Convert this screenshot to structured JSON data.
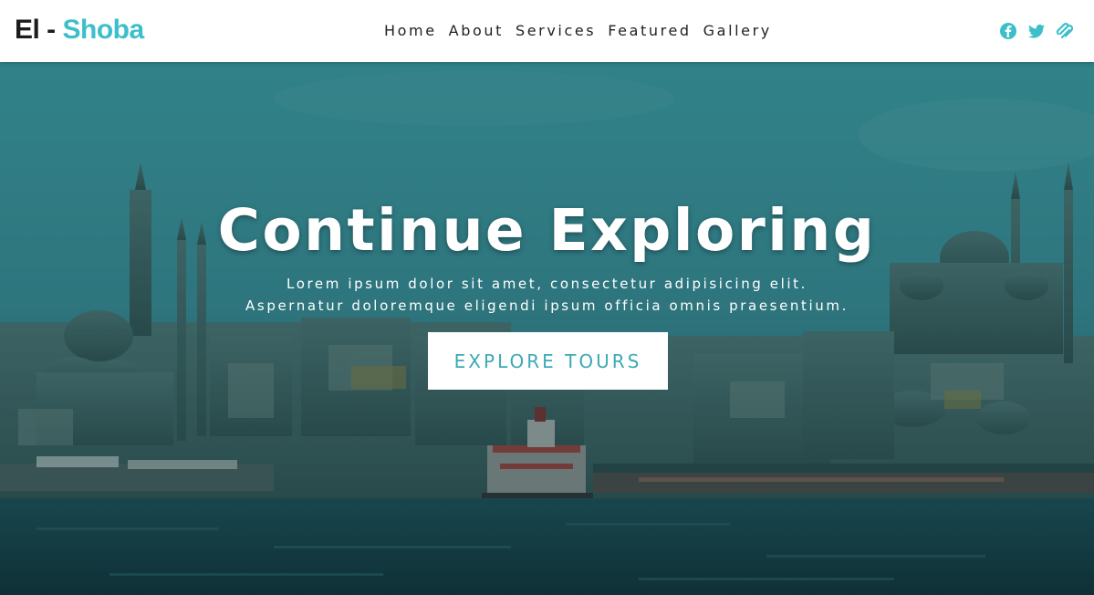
{
  "brand": {
    "part1": "El - ",
    "part2": "Shoba"
  },
  "nav": {
    "items": [
      "Home",
      "About",
      "Services",
      "Featured",
      "Gallery"
    ]
  },
  "social": {
    "icons": [
      "facebook-icon",
      "twitter-icon",
      "squarespace-icon"
    ],
    "color": "#3cbfca"
  },
  "hero": {
    "title": "Continue Exploring",
    "subtitle_line1": "Lorem ipsum dolor sit amet, consectetur adipisicing elit.",
    "subtitle_line2": "Aspernatur doloremque eligendi ipsum officia omnis praesentium.",
    "button_label": "EXPLORE TOURS",
    "overlay_color": "#2f9aa5"
  }
}
